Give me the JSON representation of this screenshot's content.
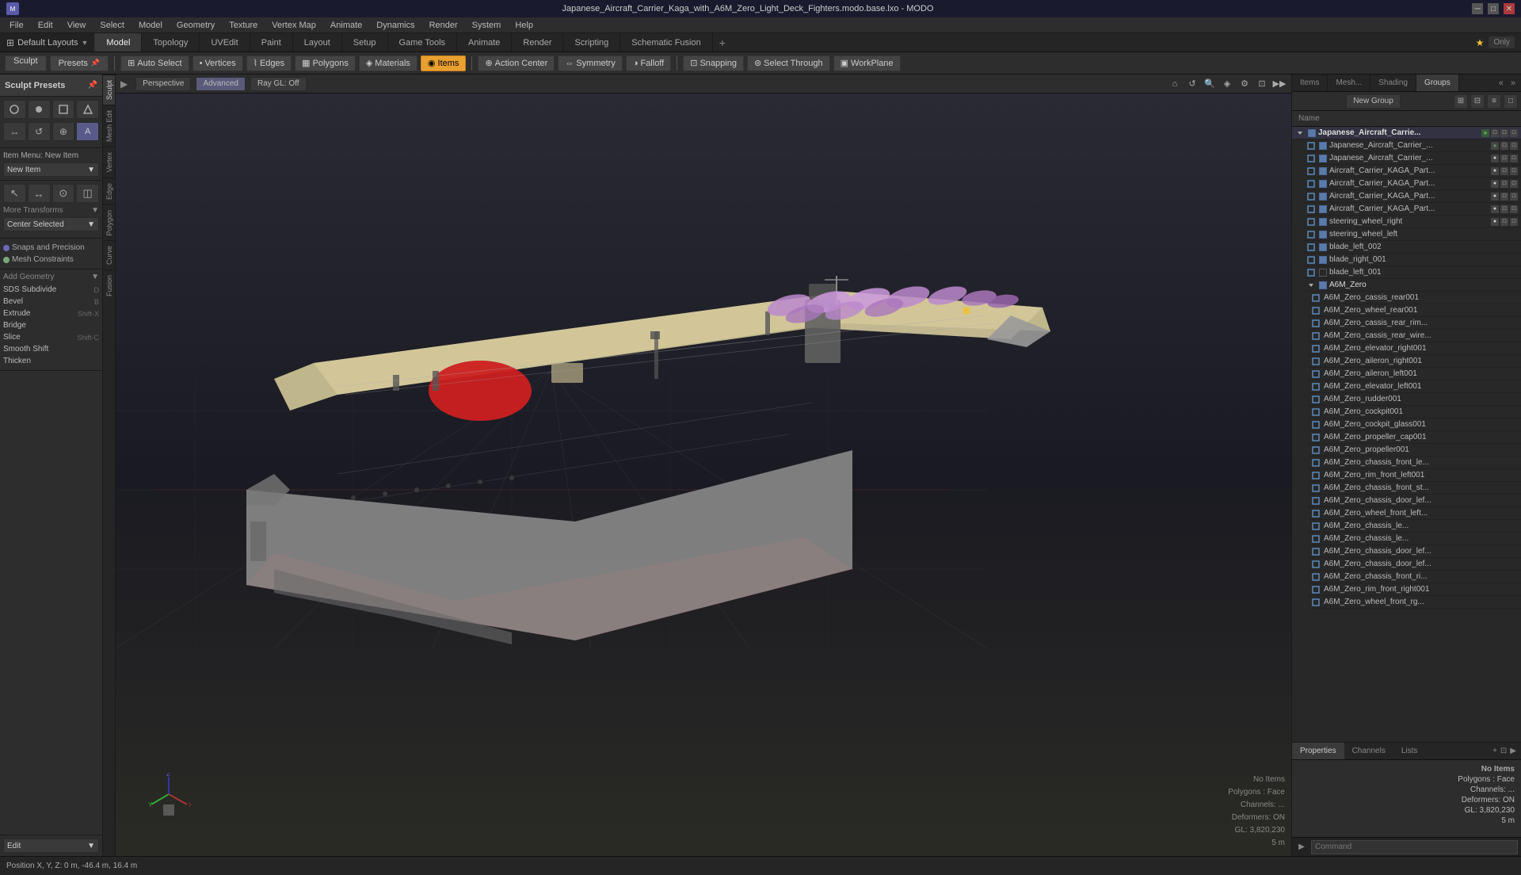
{
  "window": {
    "title": "Japanese_Aircraft_Carrier_Kaga_with_A6M_Zero_Light_Deck_Fighters.modo.base.lxo - MODO"
  },
  "titlebar": {
    "controls": [
      "─",
      "□",
      "✕"
    ]
  },
  "menubar": {
    "items": [
      "File",
      "Edit",
      "View",
      "Select",
      "Model",
      "Geometry",
      "Texture",
      "Vertex Map",
      "Animate",
      "Dynamics",
      "Render",
      "System",
      "Help"
    ]
  },
  "layout_bar": {
    "left_icon": "≡",
    "dropdown": "Default Layouts"
  },
  "tabs": {
    "items": [
      "Model",
      "Topology",
      "UVEdit",
      "Paint",
      "Layout",
      "Setup",
      "Game Tools",
      "Animate",
      "Render",
      "Scripting",
      "Schematic Fusion"
    ],
    "active": "Model",
    "right": {
      "star": "★",
      "only": "Only"
    }
  },
  "toolbar": {
    "sculpt": "Sculpt",
    "presets": "Presets",
    "pin_icon": "📌",
    "tools": [
      {
        "label": "Auto Select",
        "icon": "⊞",
        "active": false
      },
      {
        "label": "Vertices",
        "icon": "•",
        "active": false
      },
      {
        "label": "Edges",
        "icon": "⌇",
        "active": false
      },
      {
        "label": "Polygons",
        "icon": "▦",
        "active": false
      },
      {
        "label": "Materials",
        "icon": "◈",
        "active": false
      },
      {
        "label": "Items",
        "icon": "◉",
        "active": true
      },
      {
        "label": "Action Center",
        "icon": "⊕",
        "active": false
      },
      {
        "label": "Symmetry",
        "icon": "⇔",
        "active": false
      },
      {
        "label": "Falloff",
        "icon": "◑",
        "active": false
      },
      {
        "label": "Snapping",
        "icon": "⊡",
        "active": false
      },
      {
        "label": "Select Through",
        "icon": "⊚",
        "active": false
      },
      {
        "label": "WorkPlane",
        "icon": "▣",
        "active": false
      }
    ]
  },
  "viewport_bar": {
    "perspective": "Perspective",
    "advanced": "Advanced",
    "ray_gl": "Ray GL: Off"
  },
  "left_panel": {
    "sculpt_section": {
      "title": "Sculpt Presets",
      "pin_visible": true
    },
    "tools_row1": [
      "○",
      "●",
      "□",
      "△"
    ],
    "tools_row2": [
      "↔",
      "↺",
      "⊕",
      "A"
    ],
    "item_menu": {
      "label": "Item Menu: New Item",
      "value": "New Item"
    },
    "transform_tools": [
      "↖",
      "↔",
      "⊙",
      "◫"
    ],
    "more_transforms": "More Transforms",
    "center_selected": "Center Selected",
    "snaps": {
      "title": "Snaps and Precision",
      "items": [
        "Snaps and Precision",
        "Mesh Constraints"
      ]
    },
    "geometry": {
      "title": "Add Geometry",
      "items": [
        {
          "label": "SDS Subdivide",
          "shortcut": "D"
        },
        {
          "label": "Bevel",
          "shortcut": "B"
        },
        {
          "label": "Extrude",
          "shortcut": "Shift-X"
        },
        {
          "label": "Bridge",
          "shortcut": ""
        },
        {
          "label": "Slice",
          "shortcut": "Shift-C"
        },
        {
          "label": "Smooth Shift",
          "shortcut": ""
        },
        {
          "label": "Thicken",
          "shortcut": ""
        }
      ]
    },
    "edit_dropdown": "Edit"
  },
  "vertical_tabs": [
    "Sculpt",
    "Mesh Edit",
    "Vertex",
    "Edge",
    "Polygon",
    "Curve",
    "Fusion"
  ],
  "items_list": {
    "group_header": "Japanese_Aircraft_Carrie...",
    "items": [
      "Japanese_Aircraft_Carrier_...",
      "Japanese_Aircraft_Carrier_...",
      "Aircraft_Carrier_KAGA_Part...",
      "Aircraft_Carrier_KAGA_Part...",
      "Aircraft_Carrier_KAGA_Part...",
      "Aircraft_Carrier_KAGA_Part...",
      "steering_wheel_right",
      "steering_wheel_left",
      "blade_left_002",
      "blade_right_001",
      "blade_left_001",
      "A6M_Zero",
      "A6M_Zero_cassis_rear001",
      "A6M_Zero_wheel_rear001",
      "A6M_Zero_cassis_rear_rim...",
      "A6M_Zero_cassis_rear_wire...",
      "A6M_Zero_elevator_right001",
      "A6M_Zero_aileron_right001",
      "A6M_Zero_aileron_left001",
      "A6M_Zero_elevator_left001",
      "A6M_Zero_rudder001",
      "A6M_Zero_cockpit001",
      "A6M_Zero_cockpit_glass001",
      "A6M_Zero_propeller_cap001",
      "A6M_Zero_propeller001",
      "A6M_Zero_chassis_front_le...",
      "A6M_Zero_rim_front_left001",
      "A6M_Zero_chassis_front_st...",
      "A6M_Zero_chassis_door_lef...",
      "A6M_Zero_wheel_front_left...",
      "A6M_Zero_chassis_le...",
      "A6M_Zero_chassis_le...",
      "A6M_Zero_chassis_door_lef...",
      "A6M_Zero_chassis_door_lef...",
      "A6M_Zero_chassis_front_ri...",
      "A6M_Zero_rim_front_right001",
      "A6M_Zero_wheel_front_rg..."
    ]
  },
  "right_tabs": {
    "items": [
      "Items",
      "Mesh...",
      "Shading",
      "Groups"
    ],
    "active": "Groups"
  },
  "right_toolbar": {
    "new_group": "New Group",
    "icons": [
      "⊞",
      "⊟",
      "≡",
      "□"
    ]
  },
  "columns": {
    "name": "Name"
  },
  "bottom_right": {
    "tabs": [
      "Properties",
      "Channels",
      "Lists"
    ],
    "active": "Properties",
    "add_icon": "+",
    "properties": {
      "no_items": "No Items",
      "polygons": "Polygons : Face",
      "channels": "Channels: ...",
      "deformers": "Deformers: ON",
      "gl": "GL: 3,820,230",
      "scale": "5 m"
    }
  },
  "command_bar": {
    "placeholder": "Command"
  },
  "statusbar": {
    "position": "Position X, Y, Z:  0 m, -46.4 m, 16.4 m"
  },
  "viewport_info": {
    "no_items": "No Items",
    "polygons": "Polygons : Face",
    "channels": "Channels: ...",
    "deformers": "Deformers: ON",
    "gl": "GL: 3,820,230",
    "scale": "5 m"
  }
}
